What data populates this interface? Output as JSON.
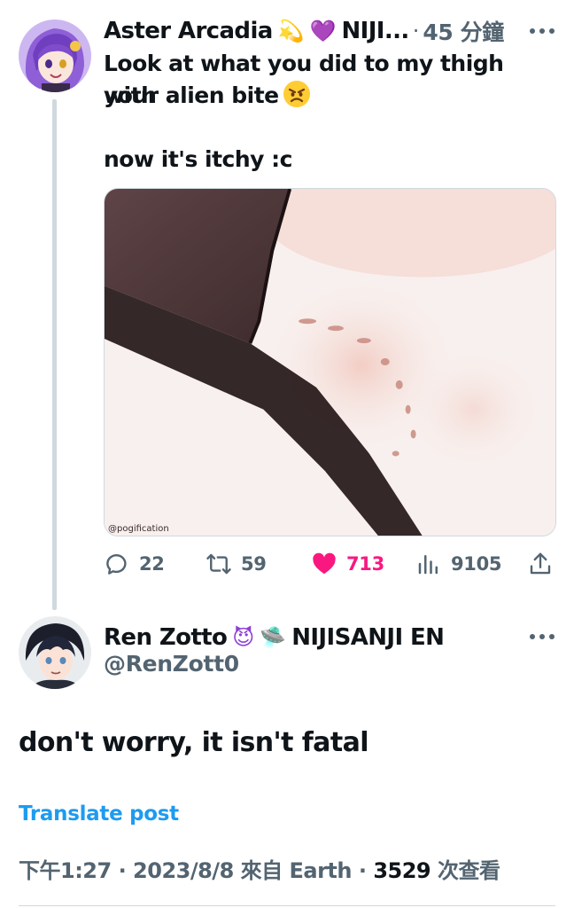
{
  "tweet1": {
    "display_name": "Aster Arcadia",
    "name_tail": "NIJI...",
    "time_ago": "45 分鐘",
    "text_line1": "Look at what you did to my thigh with",
    "text_line2": "your alien bite",
    "text_line3": "now it's itchy :c",
    "media_watermark": "@pogification",
    "stats": {
      "replies": "22",
      "reposts": "59",
      "likes": "713",
      "views": "9105"
    }
  },
  "tweet2": {
    "display_name": "Ren Zotto",
    "name_tail": "NIJISANJI EN",
    "handle": "@RenZott0",
    "text": "don't worry, it isn't fatal",
    "translate_label": "Translate post",
    "meta": {
      "time": "下午1:27",
      "date": "2023/8/8",
      "source_prefix": "來自",
      "source": "Earth",
      "views_count": "3529",
      "views_suffix": "次查看",
      "separator": "·"
    }
  },
  "colors": {
    "like_active": "#f91880",
    "link": "#1d9bf0",
    "secondary_text": "#536471"
  },
  "icons": [
    "dizzy-emoji",
    "purple-heart-emoji",
    "angry-emoji",
    "devil-emoji",
    "ufo-emoji",
    "reply-icon",
    "repost-icon",
    "heart-icon",
    "views-icon",
    "share-icon",
    "more-icon"
  ]
}
